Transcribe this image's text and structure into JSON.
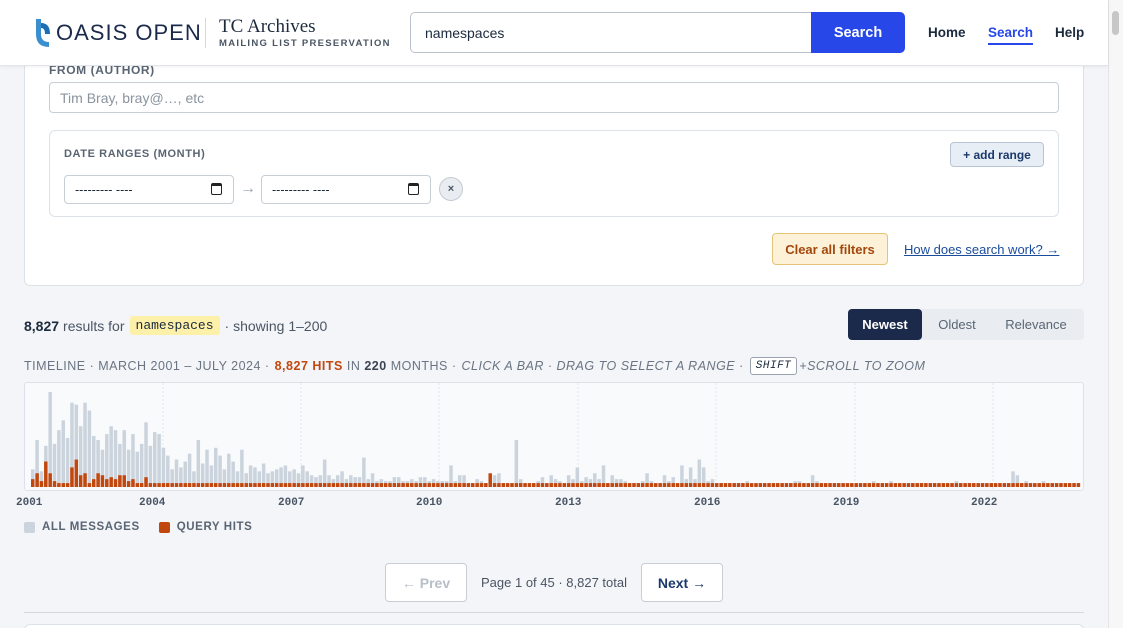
{
  "header": {
    "logo_text": "OASIS OPEN",
    "title": "TC Archives",
    "subtitle": "MAILING LIST PRESERVATION",
    "search_value": "namespaces",
    "search_button": "Search",
    "nav": [
      {
        "label": "Home",
        "active": false
      },
      {
        "label": "Search",
        "active": true
      },
      {
        "label": "Help",
        "active": false
      }
    ]
  },
  "filters": {
    "author_label": "FROM (AUTHOR)",
    "author_placeholder": "Tim Bray, bray@…, etc",
    "date_ranges_label": "DATE RANGES (MONTH)",
    "add_range": "+ add range",
    "date_start_value": "--------- ----",
    "date_end_value": "--------- ----",
    "range_arrow": "→",
    "remove_range": "×",
    "clear_all": "Clear all filters",
    "help_link": "How does search work? →"
  },
  "results": {
    "count": "8,827",
    "for_text": "results for",
    "query": "namespaces",
    "showing": "· showing 1–200",
    "sort": [
      {
        "label": "Newest",
        "active": true
      },
      {
        "label": "Oldest",
        "active": false
      },
      {
        "label": "Relevance",
        "active": false
      }
    ]
  },
  "timeline": {
    "prefix": "TIMELINE · MARCH 2001 – JULY 2024 ·",
    "hits": "8,827 HITS",
    "in_text": "IN",
    "months": "220",
    "months_text": "MONTHS ·",
    "instructions": "CLICK A BAR · DRAG TO SELECT A RANGE ·",
    "kbd": "SHIFT",
    "zoom_text": "+SCROLL TO ZOOM",
    "year_labels": [
      "2001",
      "2004",
      "2007",
      "2010",
      "2013",
      "2016",
      "2019",
      "2022"
    ],
    "legend": [
      {
        "label": "ALL MESSAGES",
        "color": "#cbd3dc"
      },
      {
        "label": "QUERY HITS",
        "color": "#c2470e"
      }
    ]
  },
  "chart_data": {
    "type": "bar",
    "title": "",
    "x_range": [
      "2001-03",
      "2024-07"
    ],
    "series": [
      {
        "name": "ALL MESSAGES",
        "values": [
          18,
          48,
          16,
          42,
          97,
          44,
          58,
          68,
          50,
          86,
          84,
          62,
          86,
          78,
          52,
          48,
          38,
          54,
          62,
          58,
          44,
          58,
          38,
          54,
          36,
          44,
          66,
          42,
          56,
          54,
          40,
          32,
          18,
          28,
          20,
          26,
          34,
          16,
          48,
          24,
          38,
          22,
          40,
          32,
          18,
          34,
          26,
          16,
          38,
          14,
          22,
          20,
          16,
          24,
          14,
          16,
          18,
          20,
          22,
          16,
          18,
          14,
          22,
          16,
          12,
          10,
          12,
          28,
          12,
          8,
          12,
          16,
          8,
          12,
          10,
          10,
          30,
          8,
          14,
          6,
          8,
          6,
          6,
          10,
          10,
          6,
          6,
          8,
          6,
          10,
          10,
          6,
          8,
          6,
          6,
          6,
          22,
          6,
          12,
          12,
          4,
          4,
          8,
          6,
          4,
          4,
          12,
          14,
          4,
          4,
          4,
          48,
          8,
          4,
          4,
          4,
          6,
          10,
          4,
          12,
          8,
          6,
          4,
          12,
          8,
          20,
          6,
          10,
          8,
          14,
          8,
          22,
          4,
          12,
          8,
          8,
          6,
          4,
          4,
          4,
          6,
          14,
          6,
          4,
          4,
          12,
          6,
          10,
          4,
          22,
          8,
          20,
          8,
          28,
          20,
          6,
          8,
          4,
          4,
          4,
          4,
          4,
          4,
          4,
          6,
          4,
          4,
          4,
          4,
          4,
          4,
          4,
          4,
          4,
          4,
          6,
          6,
          4,
          4,
          12,
          6,
          4,
          4,
          4,
          4,
          4,
          4,
          4,
          4,
          4,
          4,
          4,
          4,
          6,
          4,
          4,
          4,
          6,
          4,
          4,
          4,
          4,
          4,
          4,
          4,
          4,
          4,
          4,
          4,
          4,
          4,
          4,
          6,
          4,
          4,
          4,
          4,
          4,
          4,
          4,
          4,
          4,
          4,
          4,
          4,
          16,
          12,
          4,
          6,
          4,
          4,
          4,
          6,
          4,
          4,
          4,
          4,
          4,
          4,
          4,
          4
        ]
      },
      {
        "name": "QUERY HITS",
        "values": [
          8,
          14,
          6,
          26,
          14,
          6,
          4,
          4,
          4,
          20,
          28,
          12,
          14,
          4,
          8,
          14,
          12,
          8,
          10,
          8,
          12,
          12,
          6,
          8,
          4,
          4,
          10,
          4,
          4,
          4,
          4,
          4,
          4,
          4,
          4,
          4,
          4,
          4,
          4,
          4,
          4,
          4,
          4,
          4,
          4,
          4,
          4,
          4,
          4,
          4,
          4,
          4,
          4,
          4,
          4,
          4,
          4,
          4,
          4,
          4,
          4,
          4,
          4,
          4,
          4,
          4,
          4,
          4,
          4,
          4,
          4,
          4,
          4,
          4,
          4,
          4,
          4,
          4,
          4,
          4,
          4,
          4,
          4,
          4,
          4,
          4,
          4,
          4,
          4,
          4,
          4,
          4,
          4,
          4,
          4,
          4,
          4,
          4,
          4,
          4,
          4,
          4,
          4,
          4,
          4,
          14,
          4,
          4,
          4,
          4,
          4,
          4,
          4,
          4,
          4,
          4,
          4,
          4,
          4,
          4,
          4,
          4,
          4,
          4,
          4,
          4,
          4,
          4,
          4,
          4,
          4,
          4,
          4,
          4,
          4,
          4,
          4,
          4,
          4,
          4,
          4,
          4,
          4,
          4,
          4,
          4,
          4,
          4,
          4,
          4,
          4,
          4,
          4,
          4,
          4,
          4,
          4,
          4,
          4,
          4,
          4,
          4,
          4,
          4,
          4,
          4,
          4,
          4,
          4,
          4,
          4,
          4,
          4,
          4,
          4,
          4,
          4,
          4,
          4,
          4,
          4,
          4,
          4,
          4,
          4,
          4,
          4,
          4,
          4,
          4,
          4,
          4,
          4,
          4,
          4,
          4,
          4,
          4,
          4,
          4,
          4,
          4,
          4,
          4,
          4,
          4,
          4,
          4,
          4,
          4,
          4,
          4,
          4,
          4,
          4,
          4,
          4,
          4,
          4,
          4,
          4,
          4,
          4,
          4,
          4,
          4,
          4,
          4,
          4,
          4,
          4,
          4,
          4,
          4,
          4,
          4,
          4,
          4,
          4,
          4,
          4,
          4,
          4,
          4,
          4,
          4,
          4,
          4
        ]
      }
    ]
  },
  "pager": {
    "prev": "← Prev",
    "info": "Page 1 of 45 · 8,827 total",
    "next": "Next →"
  }
}
